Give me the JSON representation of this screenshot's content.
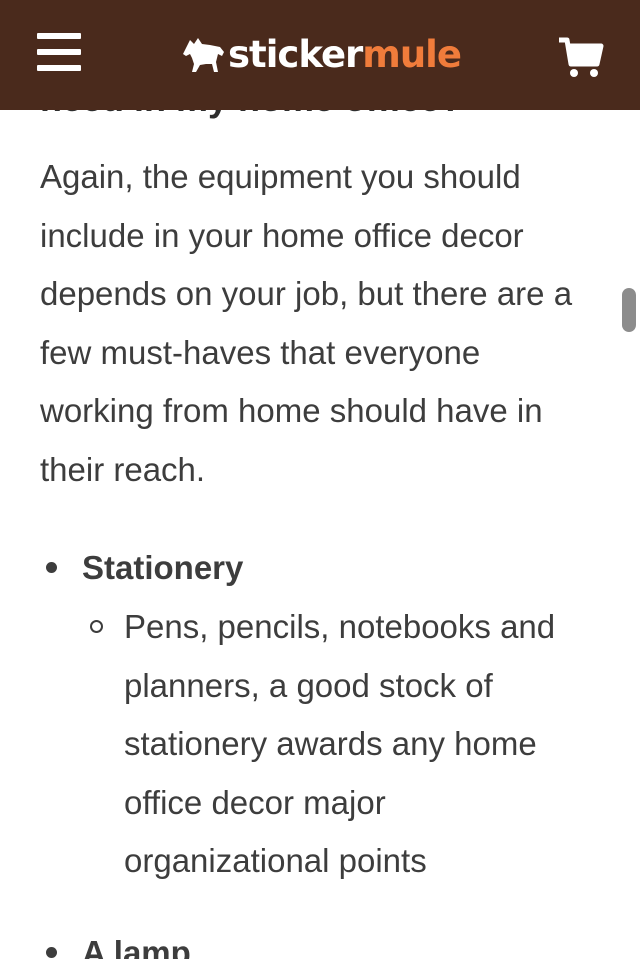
{
  "header": {
    "logo_sticker": "sticker",
    "logo_mule": "mule",
    "menu_icon": "hamburger-menu-icon",
    "cart_icon": "shopping-cart-icon",
    "colors": {
      "background": "#4a2a1c",
      "accent": "#f07c3b",
      "text": "#ffffff"
    }
  },
  "article": {
    "clipped_heading": "need in my home office?",
    "paragraph": "Again, the equipment you should include in your home office decor depends on your job, but there are a few must-haves that everyone working from home should have in their reach.",
    "list": [
      {
        "title": "Stationery",
        "sub_items": [
          "Pens, pencils, notebooks and planners, a good stock of stationery awards any home office decor major organizational points"
        ]
      },
      {
        "title": "A lamp"
      }
    ]
  }
}
